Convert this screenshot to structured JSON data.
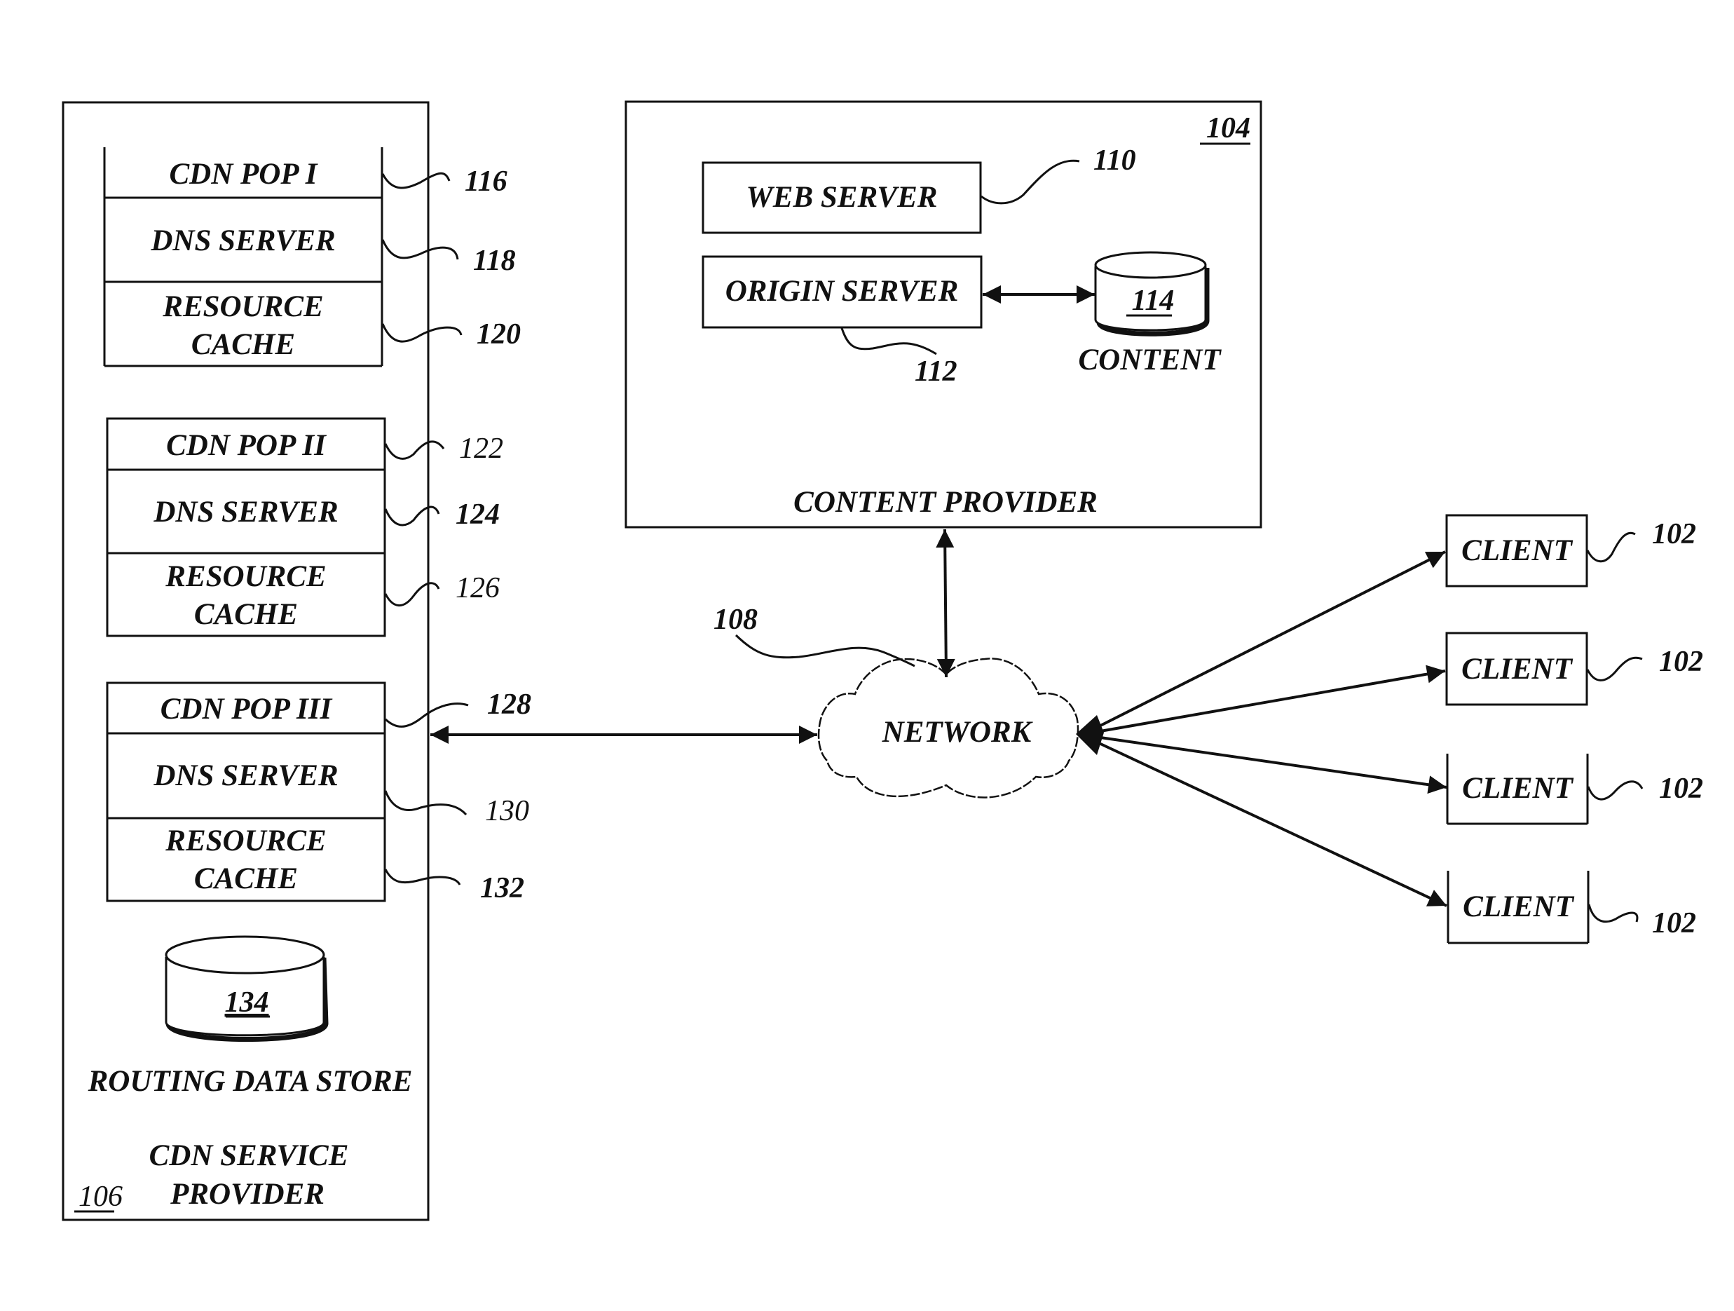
{
  "diagram": {
    "cdn_provider": {
      "title_line1": "CDN SERVICE",
      "title_line2": "PROVIDER",
      "ref": "106",
      "pops": [
        {
          "name": "CDN POP I",
          "ref": "116",
          "dns_label": "DNS SERVER",
          "dns_ref": "118",
          "cache_line1": "RESOURCE",
          "cache_line2": "CACHE",
          "cache_ref": "120"
        },
        {
          "name": "CDN POP II",
          "ref": "122",
          "dns_label": "DNS SERVER",
          "dns_ref": "124",
          "cache_line1": "RESOURCE",
          "cache_line2": "CACHE",
          "cache_ref": "126"
        },
        {
          "name": "CDN POP III",
          "ref": "128",
          "dns_label": "DNS SERVER",
          "dns_ref": "130",
          "cache_line1": "RESOURCE",
          "cache_line2": "CACHE",
          "cache_ref": "132"
        }
      ],
      "routing_store": {
        "ref": "134",
        "label": "ROUTING DATA STORE"
      }
    },
    "content_provider": {
      "title": "CONTENT PROVIDER",
      "ref": "104",
      "web_server": {
        "label": "WEB SERVER",
        "ref": "110"
      },
      "origin_server": {
        "label": "ORIGIN SERVER",
        "ref": "112"
      },
      "content_store": {
        "ref": "114",
        "label": "CONTENT"
      }
    },
    "network": {
      "label": "NETWORK",
      "ref": "108"
    },
    "clients": [
      {
        "label": "CLIENT",
        "ref": "102"
      },
      {
        "label": "CLIENT",
        "ref": "102"
      },
      {
        "label": "CLIENT",
        "ref": "102"
      },
      {
        "label": "CLIENT",
        "ref": "102"
      }
    ],
    "connections": [
      {
        "from": "CDN SERVICE PROVIDER",
        "to": "NETWORK",
        "type": "bidirectional"
      },
      {
        "from": "CONTENT PROVIDER",
        "to": "NETWORK",
        "type": "bidirectional"
      },
      {
        "from": "ORIGIN SERVER",
        "to": "CONTENT",
        "type": "bidirectional"
      },
      {
        "from": "NETWORK",
        "to": "CLIENT 1",
        "type": "bidirectional"
      },
      {
        "from": "NETWORK",
        "to": "CLIENT 2",
        "type": "bidirectional"
      },
      {
        "from": "NETWORK",
        "to": "CLIENT 3",
        "type": "bidirectional"
      },
      {
        "from": "NETWORK",
        "to": "CLIENT 4",
        "type": "bidirectional"
      }
    ]
  }
}
